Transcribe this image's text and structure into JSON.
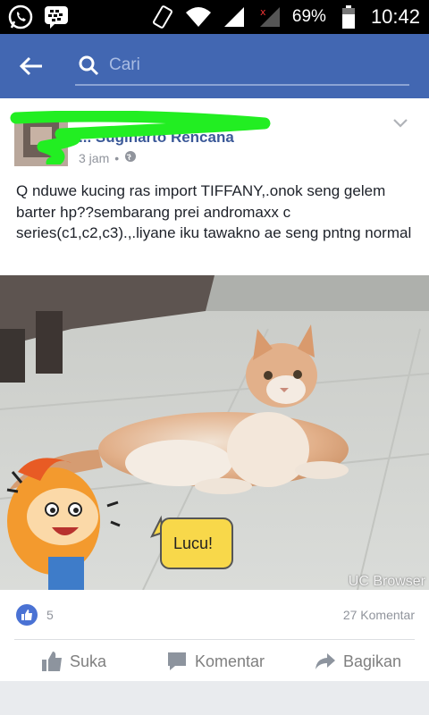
{
  "status_bar": {
    "battery_percent": "69%",
    "time": "10:42",
    "icons": [
      "whatsapp-icon",
      "bbm-icon",
      "vibrate-icon",
      "wifi-icon",
      "signal-icon",
      "no-signal-icon",
      "battery-icon"
    ]
  },
  "header": {
    "search_placeholder": "Cari",
    "accent": "#4267b2"
  },
  "post": {
    "author": "... Sugiharto Rencana",
    "time": "3 jam",
    "privacy_icon": "globe-icon",
    "text": "Q nduwe kucing ras import TIFFANY,.onok seng gelem barter hp??sembarang prei andromaxx c series(c1,c2,c3).,.liyane iku tawakno ae seng pntng normal",
    "image": {
      "sticker_text": "Lucu!",
      "watermark": "UC Browser"
    },
    "likes": "5",
    "comments": "27 Komentar",
    "actions": {
      "like": "Suka",
      "comment": "Komentar",
      "share": "Bagikan"
    }
  }
}
